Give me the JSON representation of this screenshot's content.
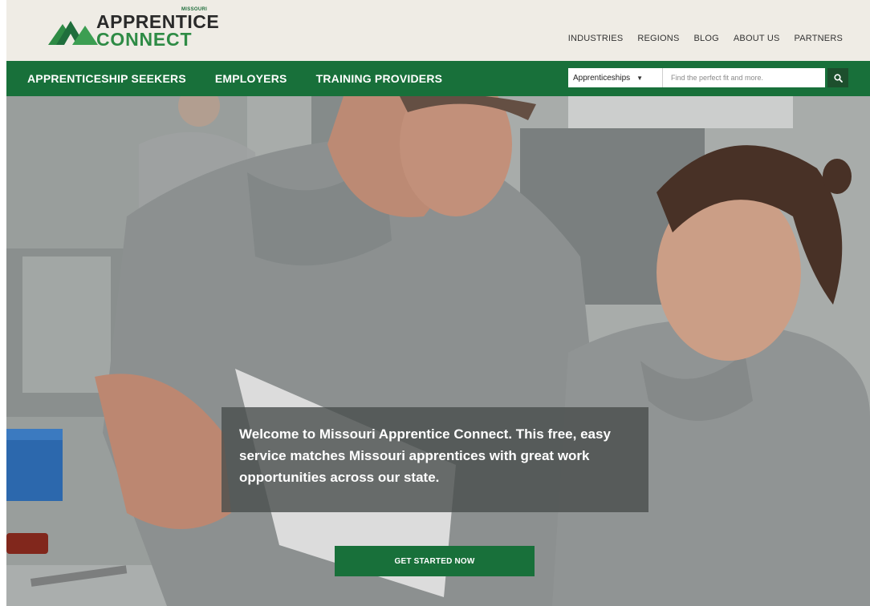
{
  "logo": {
    "state": "MISSOURI",
    "line1": "APPRENTICE",
    "line2": "CONNECT"
  },
  "utility_nav": [
    "INDUSTRIES",
    "REGIONS",
    "BLOG",
    "ABOUT US",
    "PARTNERS"
  ],
  "main_nav": [
    "APPRENTICESHIP SEEKERS",
    "EMPLOYERS",
    "TRAINING PROVIDERS"
  ],
  "search": {
    "category": "Apprenticeships",
    "placeholder": "Find the perfect fit and more.",
    "icon": "search-icon"
  },
  "hero": {
    "welcome": "Welcome to Missouri Apprentice Connect. This free, easy service matches Missouri apprentices with great work opportunities across our state.",
    "cta": "GET STARTED NOW"
  },
  "colors": {
    "brand_green": "#18703a",
    "header_bg": "#efece5",
    "search_button": "#1d4f2d"
  }
}
